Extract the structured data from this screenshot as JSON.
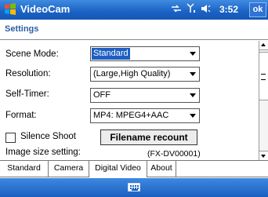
{
  "window": {
    "title": "VideoCam",
    "clock": "3:52",
    "ok_label": "ok"
  },
  "status_icons": [
    "connectivity-icon",
    "signal-icon",
    "volume-icon"
  ],
  "page": {
    "title": "Settings"
  },
  "settings": {
    "scene_mode": {
      "label": "Scene Mode:",
      "value": "Standard"
    },
    "resolution": {
      "label": "Resolution:",
      "value": "(Large,High Quality)"
    },
    "self_timer": {
      "label": "Self-Timer:",
      "value": "OFF"
    },
    "format": {
      "label": "Format:",
      "value": "MP4: MPEG4+AAC"
    },
    "silence_shoot": {
      "label": "Silence Shoot",
      "checked": false
    },
    "filename_recount_label": "Filename recount",
    "image_size_label": "Image size setting:",
    "image_size_value": "(FX-DV00001)"
  },
  "tabs": [
    {
      "label": "Standard",
      "active": false
    },
    {
      "label": "Camera",
      "active": false
    },
    {
      "label": "Digital Video",
      "active": true
    },
    {
      "label": "About",
      "active": false
    }
  ],
  "colors": {
    "titlebar": "#1a62c4",
    "settings_title": "#2a5ea8",
    "selection": "#1e5fc2"
  }
}
